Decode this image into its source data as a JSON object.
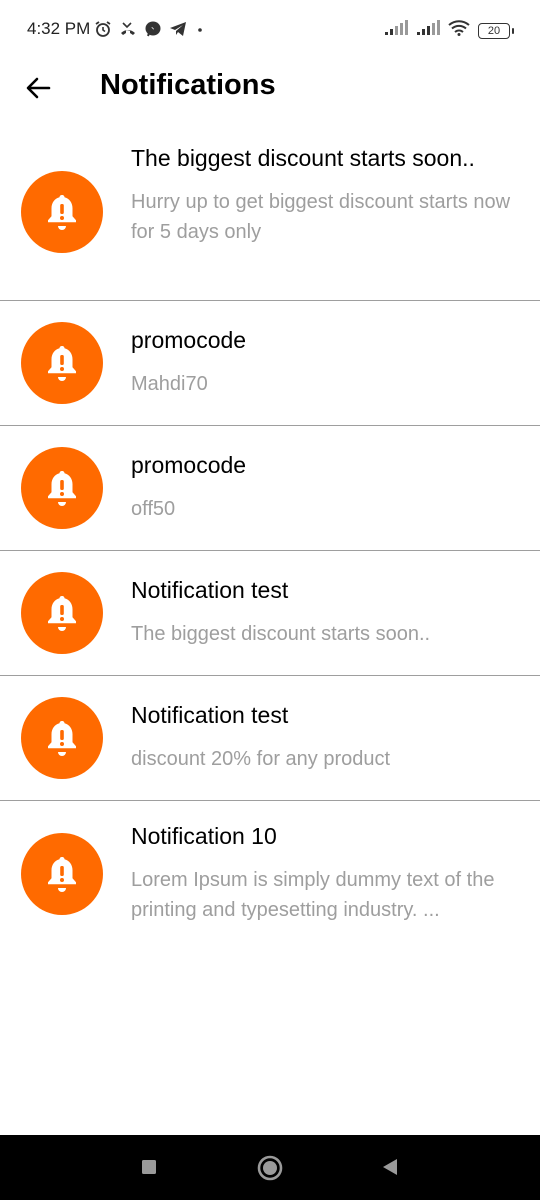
{
  "status_bar": {
    "time": "4:32 PM",
    "battery": "20",
    "icons_left": [
      "alarm-icon",
      "missed-call-icon",
      "messenger-icon",
      "telegram-icon",
      "dot-icon"
    ],
    "icons_right": [
      "signal-icon",
      "signal-icon",
      "wifi-icon",
      "battery-icon"
    ]
  },
  "header": {
    "back_icon": "arrow-left-icon",
    "title": "Notifications"
  },
  "accent_color": "#ff6a00",
  "notifications": [
    {
      "icon": "bell-alert-icon",
      "title": "The biggest discount starts soon..",
      "body": "Hurry up to get biggest discount starts now for 5 days only"
    },
    {
      "icon": "bell-alert-icon",
      "title": "promocode",
      "body": "Mahdi70"
    },
    {
      "icon": "bell-alert-icon",
      "title": "promocode",
      "body": "off50"
    },
    {
      "icon": "bell-alert-icon",
      "title": "Notification test",
      "body": "The biggest discount starts soon.."
    },
    {
      "icon": "bell-alert-icon",
      "title": "Notification test",
      "body": "discount 20% for any product"
    },
    {
      "icon": "bell-alert-icon",
      "title": "Notification 10",
      "body": "Lorem Ipsum is simply dummy text of the printing and typesetting industry. ..."
    }
  ],
  "nav_bar": {
    "buttons": [
      "recents-square-icon",
      "home-circle-icon",
      "back-triangle-icon"
    ]
  }
}
